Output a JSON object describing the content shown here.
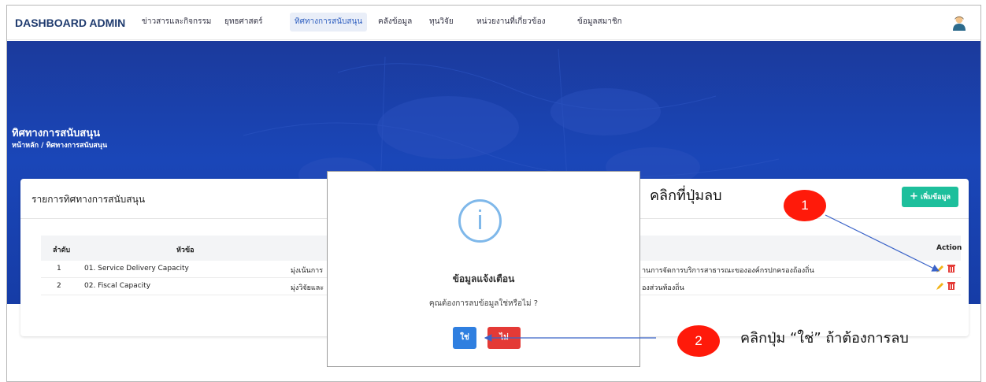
{
  "navbar": {
    "brand": "DASHBOARD ADMIN",
    "items": [
      {
        "label": "ข่าวสารและกิจกรรม",
        "active": false
      },
      {
        "label": "ยุทธศาสตร์",
        "active": false
      },
      {
        "label": "ทิศทางการสนับสนุน",
        "active": true
      },
      {
        "label": "คลังข้อมูล",
        "active": false
      },
      {
        "label": "ทุนวิจัย",
        "active": false
      },
      {
        "label": "หน่วยงานที่เกี่ยวข้อง",
        "active": false
      },
      {
        "label": "ข้อมูลสมาชิก",
        "active": false
      }
    ],
    "avatar_icon": "user-avatar-icon"
  },
  "hero": {
    "title": "ทิศทางการสนับสนุน",
    "breadcrumb": "หน้าหลัก / ทิศทางการสนับสนุน"
  },
  "card": {
    "title": "รายการทิศทางการสนับสนุน",
    "add_button": "เพิ่มข้อมูล",
    "add_icon": "plus-icon"
  },
  "table": {
    "headers": {
      "index": "ลำดับ",
      "topic": "หัวข้อ",
      "action": "Action"
    },
    "rows": [
      {
        "index": "1",
        "topic": "01. Service Delivery Capacity",
        "desc_left": "มุ่งเน้นการ",
        "desc_right": "านการจัดการบริการสาธารณะขององค์กรปกครองถ้องถิ่น"
      },
      {
        "index": "2",
        "topic": "02. Fiscal Capacity",
        "desc_left": "มุ่งวิจัยและ",
        "desc_right": "องส่วนท้องถิ่น"
      }
    ],
    "edit_icon": "pencil-icon",
    "delete_icon": "trash-icon"
  },
  "modal": {
    "icon": "info-icon",
    "icon_glyph": "i",
    "title": "ข้อมูลแจ้งเตือน",
    "message": "คุณต้องการลบข้อมูลใช่หรือไม่ ?",
    "yes_label": "ใช่",
    "no_label": "ไม่"
  },
  "annotations": {
    "step1_number": "1",
    "step1_text": "คลิกที่ปุ่มลบ",
    "step2_number": "2",
    "step2_text": "คลิกปุ่ม “ใช่” ถ้าต้องการลบ"
  },
  "colors": {
    "accent": "#2f7fe0",
    "danger": "#e43a36",
    "success": "#1dbf9c",
    "hero": "#1a46b8",
    "badge": "#ff1a0a"
  }
}
